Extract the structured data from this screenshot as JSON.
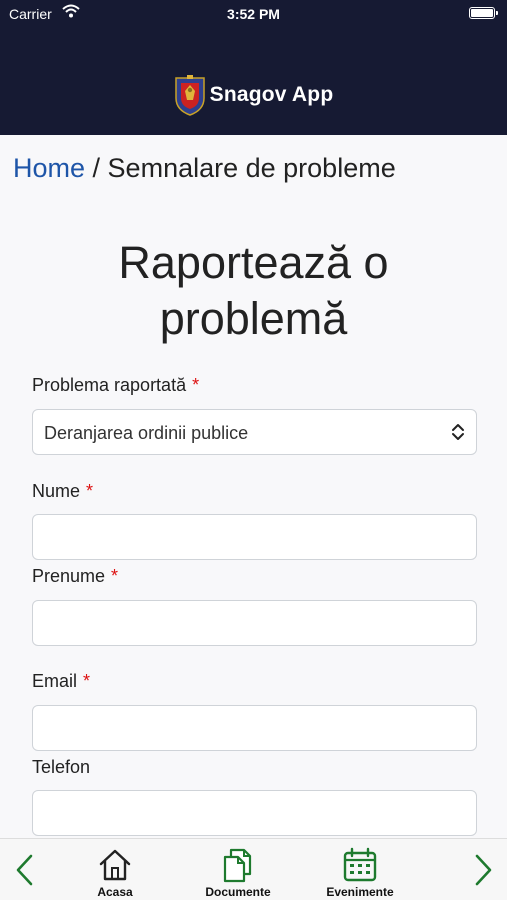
{
  "status_bar": {
    "carrier": "Carrier",
    "time": "3:52 PM"
  },
  "app": {
    "name": "Snagov App"
  },
  "breadcrumb": {
    "home": "Home",
    "separator": " / ",
    "current": "Semnalare de probleme"
  },
  "page": {
    "title": "Raportează o problemă"
  },
  "form": {
    "problem": {
      "label": "Problema raportată",
      "required_mark": "*",
      "value": "Deranjarea ordinii publice"
    },
    "nume": {
      "label": "Nume",
      "required_mark": "*",
      "value": ""
    },
    "prenume": {
      "label": "Prenume",
      "required_mark": "*",
      "value": ""
    },
    "email": {
      "label": "Email",
      "required_mark": "*",
      "value": ""
    },
    "telefon": {
      "label": "Telefon",
      "value": ""
    }
  },
  "tabs": [
    {
      "label": "Acasa",
      "icon": "home-icon"
    },
    {
      "label": "Documente",
      "icon": "documents-icon"
    },
    {
      "label": "Evenimente",
      "icon": "calendar-icon"
    }
  ],
  "colors": {
    "header": "#161a33",
    "link": "#1e55a8",
    "required": "#dd1111",
    "tab_icon": "#1e7a2e"
  }
}
